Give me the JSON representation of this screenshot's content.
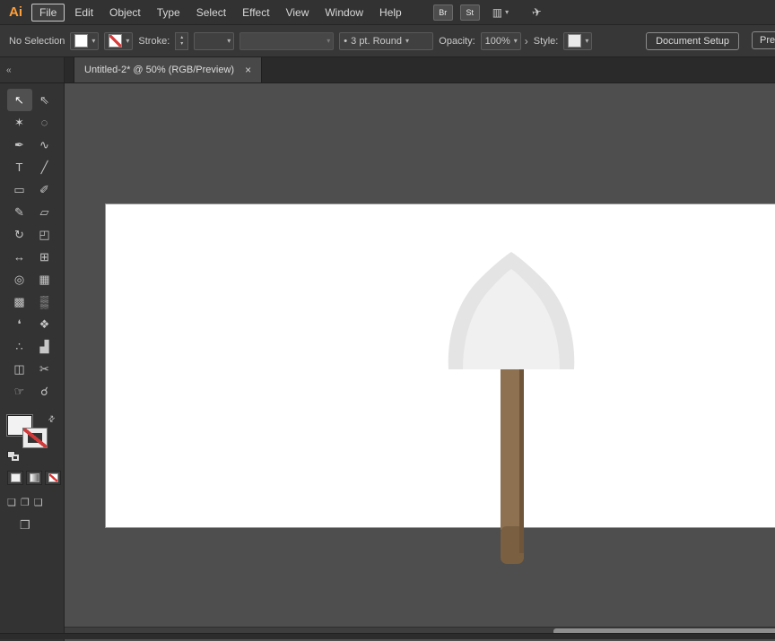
{
  "app": {
    "logo_text": "Ai",
    "logo_color": "#ff9f3a"
  },
  "icons": {
    "chevron_down": "▾",
    "chevron_up": "▴",
    "flyout_arrow": "›",
    "swap_arrows": "⇄",
    "collapse": "«",
    "close": "×",
    "workspace_grid": "▥",
    "rocket": "✈",
    "draw_normal": "❏",
    "draw_behind": "❐",
    "draw_inside": "❑",
    "screen_mode": "❒"
  },
  "menubar": {
    "items": [
      "File",
      "Edit",
      "Object",
      "Type",
      "Select",
      "Effect",
      "View",
      "Window",
      "Help"
    ],
    "bridge_button": "Br",
    "stock_button": "St"
  },
  "control_bar": {
    "selection_status": "No Selection",
    "stroke_label": "Stroke:",
    "brush_preview": "•",
    "brush_name": "3 pt. Round",
    "opacity_label": "Opacity:",
    "opacity_value": "100%",
    "style_label": "Style:",
    "document_setup_button": "Document Setup",
    "preferences_button": "Preferences"
  },
  "tab": {
    "title": "Untitled-2* @ 50% (RGB/Preview)"
  },
  "tools_panel": {
    "tools": [
      {
        "name": "selection",
        "glyph": "↖",
        "active": true
      },
      {
        "name": "direct-selection",
        "glyph": "⇖"
      },
      {
        "name": "magic-wand",
        "glyph": "✶"
      },
      {
        "name": "lasso",
        "glyph": "◌"
      },
      {
        "name": "pen",
        "glyph": "✒"
      },
      {
        "name": "curvature",
        "glyph": "∿"
      },
      {
        "name": "type",
        "glyph": "T"
      },
      {
        "name": "line-segment",
        "glyph": "╱"
      },
      {
        "name": "rectangle",
        "glyph": "▭"
      },
      {
        "name": "paintbrush",
        "glyph": "✐"
      },
      {
        "name": "pencil",
        "glyph": "✎"
      },
      {
        "name": "eraser",
        "glyph": "▱"
      },
      {
        "name": "rotate",
        "glyph": "↻"
      },
      {
        "name": "scale",
        "glyph": "◰"
      },
      {
        "name": "width",
        "glyph": "↔"
      },
      {
        "name": "free-transform",
        "glyph": "⊞"
      },
      {
        "name": "shape-builder",
        "glyph": "◎"
      },
      {
        "name": "perspective-grid",
        "glyph": "▦"
      },
      {
        "name": "mesh",
        "glyph": "▩"
      },
      {
        "name": "gradient",
        "glyph": "▒"
      },
      {
        "name": "eyedropper",
        "glyph": "❛"
      },
      {
        "name": "blend",
        "glyph": "❖"
      },
      {
        "name": "symbol-sprayer",
        "glyph": "∴"
      },
      {
        "name": "column-graph",
        "glyph": "▟"
      },
      {
        "name": "artboard",
        "glyph": "◫"
      },
      {
        "name": "slice",
        "glyph": "✂"
      },
      {
        "name": "hand",
        "glyph": "☞"
      },
      {
        "name": "zoom",
        "glyph": "☌"
      }
    ]
  },
  "canvas": {
    "artboard_color": "#ffffff",
    "shovel": {
      "head_fill": "#e4e4e4",
      "head_highlight": "#f0f0f0",
      "handle_fill": "#8d7150",
      "handle_shade": "#6f5539",
      "handle_below": "#7a5f41"
    }
  },
  "colors": {
    "stroke_none_red": "#d83a3a",
    "ui_bg": "#333333",
    "canvas_bg": "#4e4e4e"
  }
}
